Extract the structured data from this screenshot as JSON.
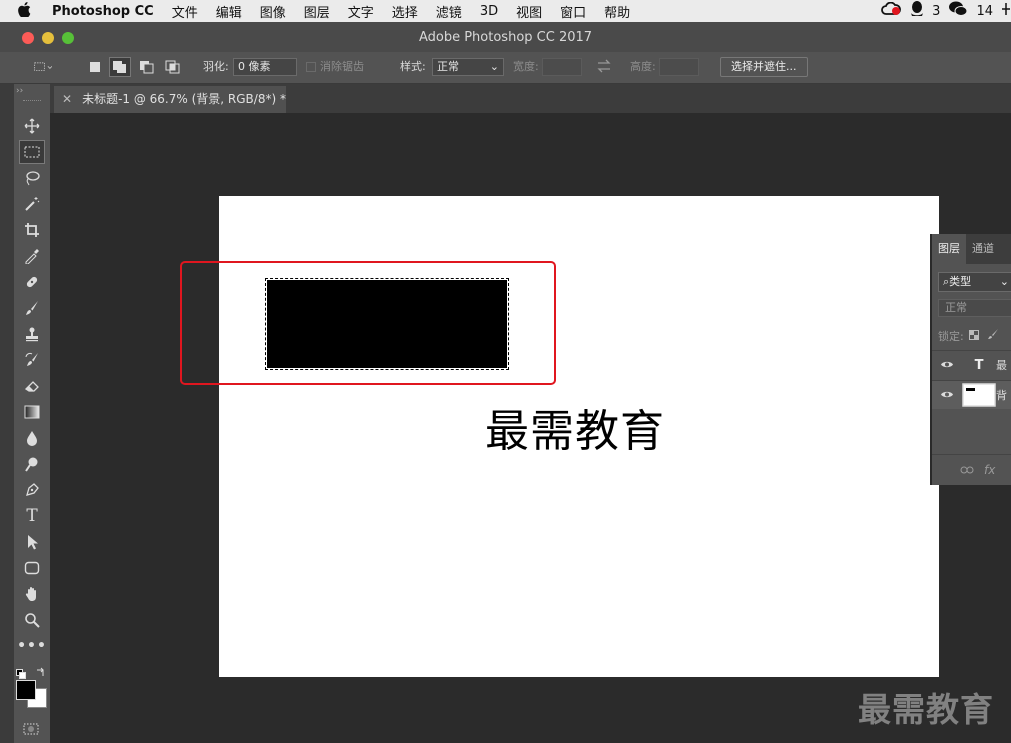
{
  "menubar": {
    "app_name": "Photoshop CC",
    "menus": [
      "文件",
      "编辑",
      "图像",
      "图层",
      "文字",
      "选择",
      "滤镜",
      "3D",
      "视图",
      "窗口",
      "帮助"
    ],
    "qq_count": "3",
    "wechat_count": "14"
  },
  "window": {
    "title": "Adobe Photoshop CC 2017"
  },
  "options_bar": {
    "feather_label": "羽化:",
    "feather_value": "0 像素",
    "anti_alias_label": "消除锯齿",
    "style_label": "样式:",
    "style_value": "正常",
    "width_label": "宽度:",
    "height_label": "高度:",
    "select_mask_button": "选择并遮住..."
  },
  "document": {
    "tab_title": "未标题-1 @ 66.7% (背景, RGB/8*) *",
    "canvas_text": "最需教育"
  },
  "layers_panel": {
    "tabs": [
      "图层",
      "通道"
    ],
    "filter_kind": "类型",
    "blend_mode": "正常",
    "lock_label": "锁定:",
    "layers": [
      {
        "type_glyph": "T",
        "name": "最"
      },
      {
        "name": "背"
      }
    ],
    "footer_fx": "fx"
  },
  "watermark": "最需教育",
  "colors": {
    "highlight": "#e0161f",
    "canvas_bg": "#2b2b2b"
  }
}
